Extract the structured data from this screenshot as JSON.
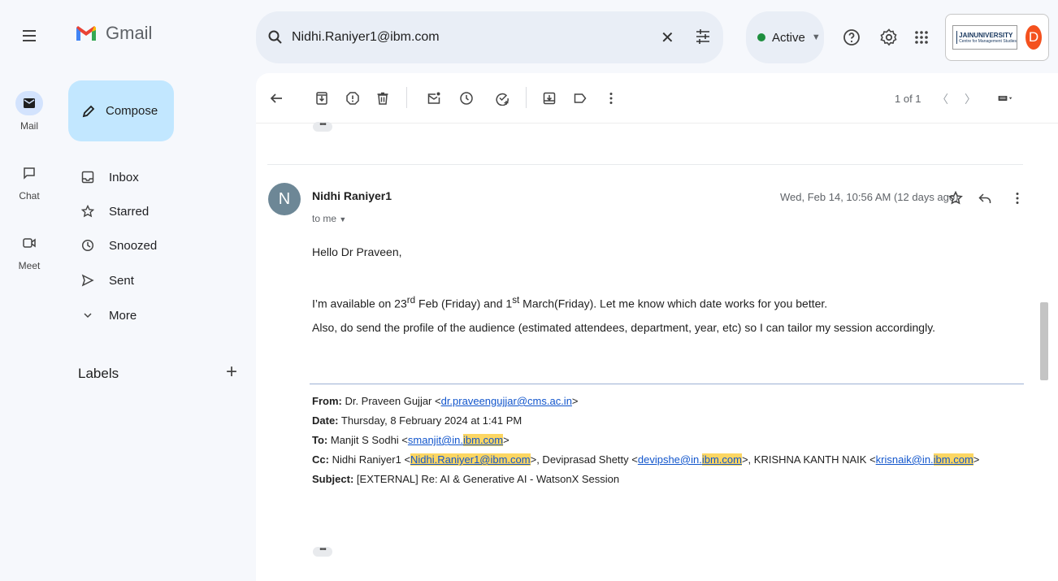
{
  "app": {
    "name": "Gmail"
  },
  "rail": [
    {
      "label": "Mail",
      "icon": "mail-icon",
      "active": true
    },
    {
      "label": "Chat",
      "icon": "chat-icon",
      "active": false
    },
    {
      "label": "Meet",
      "icon": "video-icon",
      "active": false
    }
  ],
  "compose": {
    "label": "Compose"
  },
  "nav": [
    {
      "label": "Inbox",
      "icon": "inbox-icon"
    },
    {
      "label": "Starred",
      "icon": "star-icon"
    },
    {
      "label": "Snoozed",
      "icon": "clock-icon"
    },
    {
      "label": "Sent",
      "icon": "send-icon"
    },
    {
      "label": "More",
      "icon": "chevron-down-icon"
    }
  ],
  "labels": {
    "title": "Labels",
    "add": "+"
  },
  "search": {
    "value": "Nidhi.Raniyer1@ibm.com"
  },
  "status": {
    "label": "Active",
    "color": "#1e8e3e"
  },
  "account": {
    "org_name": "JAINUNIVERSITY",
    "org_sub": "Centre for Management Studies",
    "avatar_letter": "D",
    "avatar_color": "#f4511e"
  },
  "pager": {
    "text": "1 of 1"
  },
  "message": {
    "avatar_letter": "N",
    "sender": "Nidhi Raniyer1",
    "to": "to me",
    "date": "Wed, Feb 14, 10:56 AM (12 days ago)",
    "greeting": "Hello Dr Praveen,",
    "line1": {
      "a": "I’m available on 23",
      "sup1": "rd",
      "b": " Feb (Friday) and 1",
      "sup2": "st",
      "c": " March(Friday). Let me know which date works for you better."
    },
    "line2": "Also, do send the profile of the audience (estimated attendees, department, year, etc) so I can tailor my session accordingly."
  },
  "quoted": {
    "from_label": "From:",
    "from_name": " Dr. Praveen Gujjar <",
    "from_email": "dr.praveengujjar@cms.ac.in",
    "from_end": ">",
    "date_label": "Date:",
    "date_value": " Thursday, 8 February 2024 at 1:41 PM",
    "to_label": "To:",
    "to_name": " Manjit S Sodhi <",
    "to_email_a": "smanjit@in.",
    "to_email_b": "ibm.com",
    "to_end": ">",
    "cc_label": "Cc:",
    "cc_name1": " Nidhi Raniyer1 <",
    "cc_email1": "Nidhi.Raniyer1@ibm.com",
    "cc_name2": ">, Deviprasad Shetty <",
    "cc_email2_a": "devipshe@in.",
    "cc_email2_b": "ibm.com",
    "cc_name3": ">, KRISHNA KANTH NAIK <",
    "cc_email3_a": "krisnaik@in.",
    "cc_email3_b": "ibm.com",
    "cc_end": ">",
    "subject_label": "Subject:",
    "subject_value": " [EXTERNAL] Re: AI & Generative AI - WatsonX Session"
  }
}
